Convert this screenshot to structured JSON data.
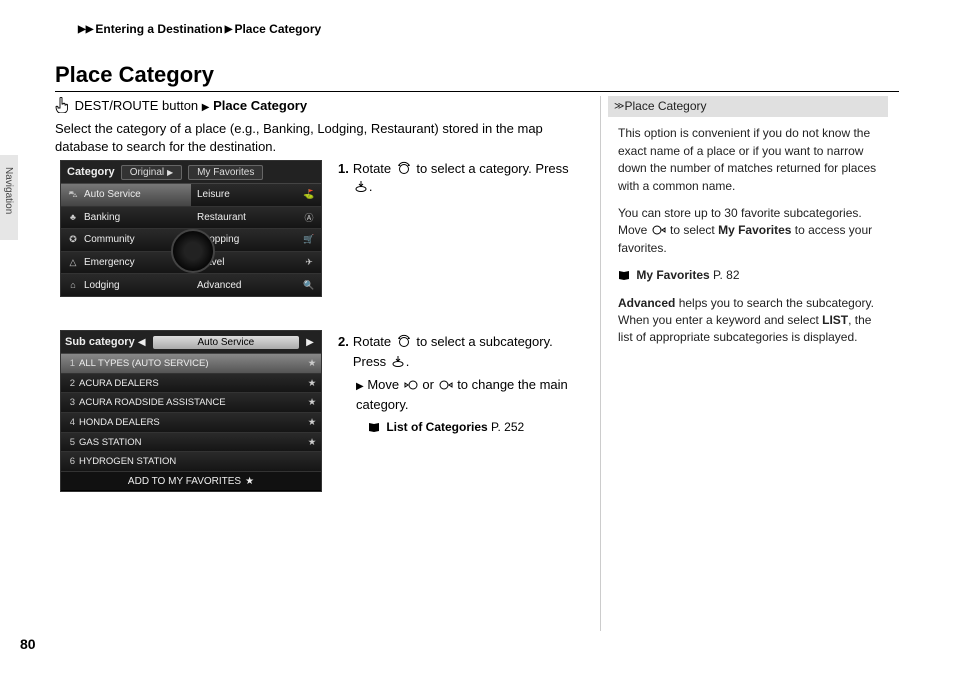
{
  "breadcrumb": {
    "part1": "Entering a Destination",
    "part2": "Place Category"
  },
  "heading": "Place Category",
  "sidebar_label": "Navigation",
  "page_number": "80",
  "intro": {
    "prefix": "DEST/ROUTE button",
    "suffix": "Place Category"
  },
  "description": "Select the category of a place (e.g., Banking, Lodging, Restaurant) stored in the map database to search for the destination.",
  "screenshot1": {
    "header_label": "Category",
    "tab1": "Original",
    "tab2": "My Favorites",
    "left_col": [
      "Auto Service",
      "Banking",
      "Community",
      "Emergency",
      "Lodging"
    ],
    "right_col": [
      "Leisure",
      "Restaurant",
      "Shopping",
      "Travel",
      "Advanced"
    ],
    "left_icons": [
      "⛍",
      "♣",
      "✪",
      "△",
      "⌂"
    ],
    "right_icons": [
      "⛳",
      "Ⓐ",
      "🛒",
      "✈",
      "🔍"
    ]
  },
  "step1": {
    "num": "1.",
    "text_a": "Rotate",
    "text_b": "to select a category. Press",
    "text_c": "."
  },
  "screenshot2": {
    "header_label": "Sub category",
    "center": "Auto Service",
    "rows": [
      {
        "n": "1",
        "t": "ALL TYPES (AUTO SERVICE)",
        "s": "★"
      },
      {
        "n": "2",
        "t": "ACURA DEALERS",
        "s": "★"
      },
      {
        "n": "3",
        "t": "ACURA ROADSIDE ASSISTANCE",
        "s": "★"
      },
      {
        "n": "4",
        "t": "HONDA DEALERS",
        "s": "★"
      },
      {
        "n": "5",
        "t": "GAS STATION",
        "s": "★"
      },
      {
        "n": "6",
        "t": "HYDROGEN STATION",
        "s": ""
      }
    ],
    "footer": "ADD TO MY FAVORITES",
    "footer_star": "★"
  },
  "step2": {
    "num": "2.",
    "text_a": "Rotate",
    "text_b": "to select a subcategory. Press",
    "text_c": ".",
    "sub_a": "Move",
    "sub_b": "or",
    "sub_c": "to change the main category.",
    "ref_label": "List of Categories",
    "ref_page": "P. 252"
  },
  "right": {
    "header": "Place Category",
    "p1": "This option is convenient if you do not know the exact name of a place or if you want to narrow down the number of matches returned for places with a common name.",
    "p2_a": "You can store up to 30 favorite subcategories. Move",
    "p2_b": "to select",
    "p2_bold": "My Favorites",
    "p2_c": "to access your favorites.",
    "ref_label": "My Favorites",
    "ref_page": "P. 82",
    "p3_bold": "Advanced",
    "p3_a": "helps you to search the subcategory. When you enter a keyword and select",
    "p3_bold2": "LIST",
    "p3_b": ", the list of appropriate subcategories is displayed."
  }
}
